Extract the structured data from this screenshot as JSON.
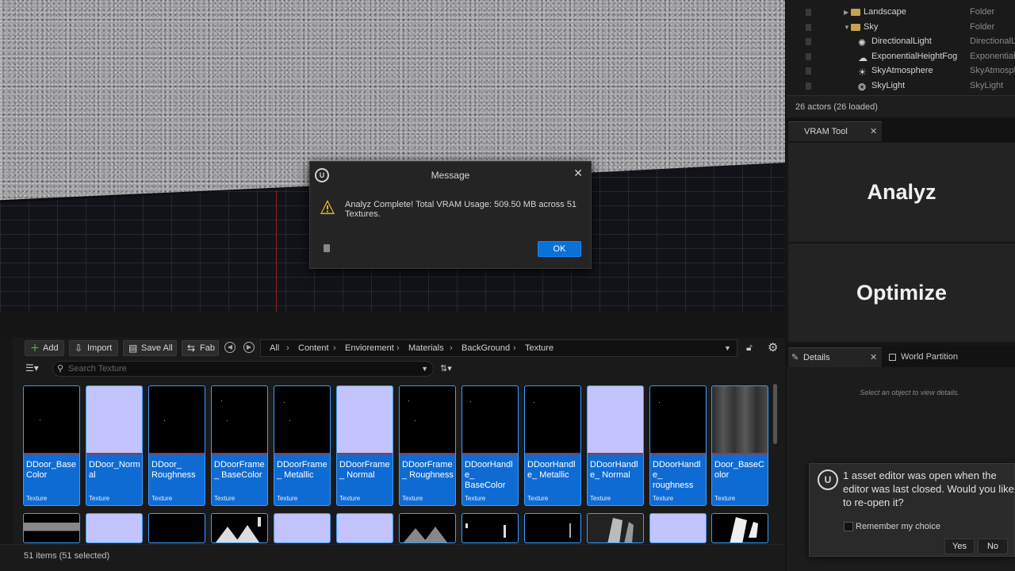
{
  "dialog": {
    "title": "Message",
    "message": "Analyz Complete! Total VRAM Usage: 509.50 MB across 51 Textures.",
    "ok_label": "OK"
  },
  "outliner": {
    "rows": [
      {
        "label": "Landscape",
        "type": "Folder",
        "kind": "folder"
      },
      {
        "label": "Sky",
        "type": "Folder",
        "kind": "folder"
      },
      {
        "label": "DirectionalLight",
        "type": "DirectionalLig",
        "kind": "actor"
      },
      {
        "label": "ExponentialHeightFog",
        "type": "ExponentialH",
        "kind": "actor"
      },
      {
        "label": "SkyAtmosphere",
        "type": "SkyAtmosphe",
        "kind": "actor"
      },
      {
        "label": "SkyLight",
        "type": "SkyLight",
        "kind": "actor"
      }
    ],
    "actor_count": "26 actors (26 loaded)"
  },
  "vram_tool": {
    "tab_label": "VRAM Tool",
    "analyz_label": "Analyz",
    "optimize_label": "Optimize"
  },
  "details": {
    "tab_label": "Details",
    "world_partition_label": "World Partition",
    "hint": "Select an object to view details."
  },
  "toast": {
    "message": "1 asset editor was open when the editor was last closed. Would you like to re-open it?",
    "checkbox_label": "Remember my choice",
    "yes_label": "Yes",
    "no_label": "No"
  },
  "content_browser": {
    "toolbar": {
      "add_label": "Add",
      "import_label": "Import",
      "save_all_label": "Save All",
      "fab_label": "Fab"
    },
    "breadcrumb": [
      "All",
      "Content",
      "Enviorement",
      "Materials",
      "BackGround",
      "Texture"
    ],
    "search_placeholder": "Search Texture",
    "tiles": [
      {
        "name": "DDoor_Base Color",
        "type": "Texture",
        "thumb": "dark"
      },
      {
        "name": "DDoor_Normal",
        "type": "Texture",
        "thumb": "normal"
      },
      {
        "name": "DDoor_ Roughness",
        "type": "Texture",
        "thumb": "dark"
      },
      {
        "name": "DDoorFrame_ BaseColor",
        "type": "Texture",
        "thumb": "dark"
      },
      {
        "name": "DDoorFrame_ Metallic",
        "type": "Texture",
        "thumb": "dark"
      },
      {
        "name": "DDoorFrame_ Normal",
        "type": "Texture",
        "thumb": "normal"
      },
      {
        "name": "DDoorFrame_ Roughness",
        "type": "Texture",
        "thumb": "dark"
      },
      {
        "name": "DDoorHandle_ BaseColor",
        "type": "Texture",
        "thumb": "dark"
      },
      {
        "name": "DDoorHandle_ Metallic",
        "type": "Texture",
        "thumb": "dark"
      },
      {
        "name": "DDoorHandle_ Normal",
        "type": "Texture",
        "thumb": "normal"
      },
      {
        "name": "DDoorHandle_ roughness",
        "type": "Texture",
        "thumb": "dark"
      },
      {
        "name": "Door_BaseColor",
        "type": "Texture",
        "thumb": "wood"
      }
    ],
    "status": "51 items (51 selected)"
  }
}
